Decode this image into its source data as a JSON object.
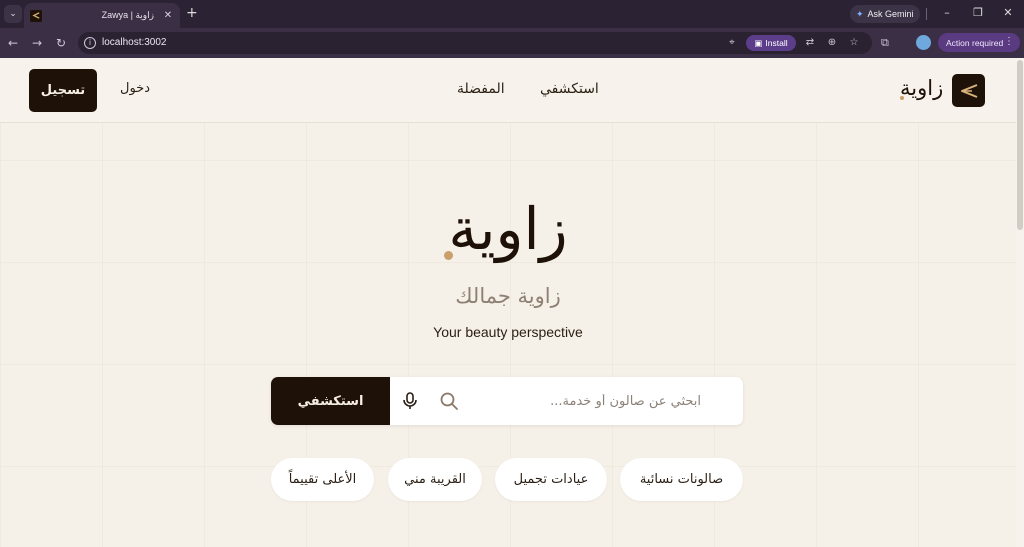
{
  "browser": {
    "tab_title": "Zawya | زاوية",
    "tab_close": "✕",
    "new_tab": "+",
    "tab_menu": "⌄",
    "gemini_label": "Ask Gemini",
    "url": "localhost:3002",
    "install_label": "Install",
    "action_required_label": "Action required"
  },
  "header": {
    "brand": "زاوية",
    "nav": {
      "explore": "استكشفي",
      "favorites": "المفضلة"
    },
    "login": "دخول",
    "signup": "تسجيل"
  },
  "hero": {
    "title": "زاوية",
    "subtitle": "زاوية جمالك",
    "tagline": "Your beauty perspective"
  },
  "search": {
    "placeholder": "ابحثي عن صالون أو خدمة...",
    "button": "استكشفي"
  },
  "chips": [
    "صالونات نسائية",
    "عيادات تجميل",
    "القريبة مني",
    "الأعلى تقييماً"
  ],
  "colors": {
    "primary": "#1e1208",
    "accent": "#c9a06a",
    "background": "#f5f0e8"
  }
}
